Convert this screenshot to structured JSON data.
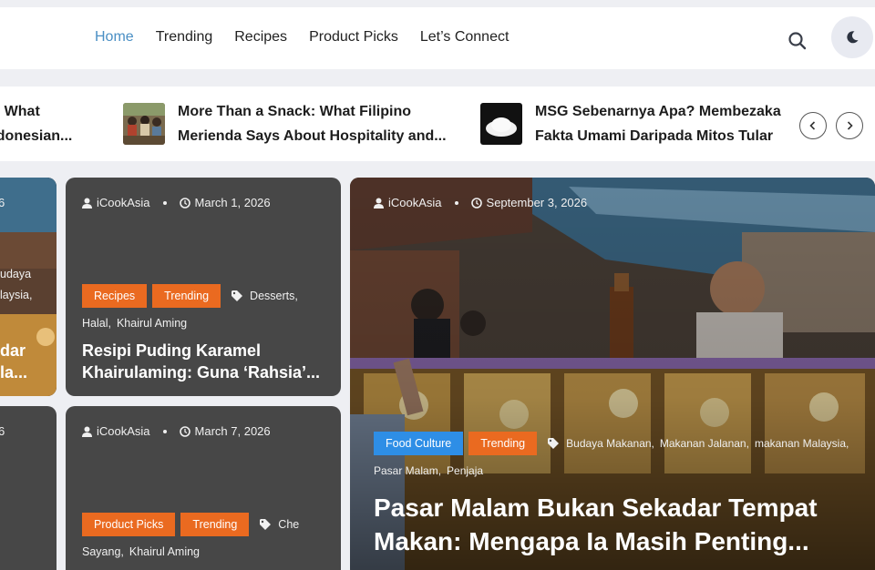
{
  "nav": {
    "items": [
      {
        "label": "Home",
        "active": true
      },
      {
        "label": "Trending"
      },
      {
        "label": "Recipes"
      },
      {
        "label": "Product Picks"
      },
      {
        "label": "Let’s Connect"
      }
    ],
    "search_icon": "search-icon",
    "mode_icon": "moon-icon"
  },
  "ticker": {
    "items": [
      {
        "title": "e: What\nndonesian..."
      },
      {
        "title": "More Than a Snack: What Filipino Merienda Says About Hospitality and..."
      },
      {
        "title": "MSG Sebenarnya Apa? Membezaka Fakta Umami Daripada Mitos Tular"
      }
    ],
    "prev_icon": "chevron-left-icon",
    "next_icon": "chevron-right-icon"
  },
  "cards": {
    "left_top": {
      "partial_tag1": "udaya",
      "partial_tag2": "laysia,",
      "partial_title1": "dar",
      "partial_title2": "la...",
      "partial_meta": "6"
    },
    "left_bottom": {
      "partial_meta": "6"
    },
    "card1": {
      "author": "iCookAsia",
      "date": "March 1, 2026",
      "categories": [
        "Recipes",
        "Trending"
      ],
      "tags_line1": "Desserts,",
      "tags_line2": [
        "Halal,",
        "Khairul Aming"
      ],
      "title": "Resipi Puding Karamel Khairulaming: Guna ‘Rahsia’..."
    },
    "card2": {
      "author": "iCookAsia",
      "date": "March 7, 2026",
      "categories": [
        "Product Picks",
        "Trending"
      ],
      "tags_line1": "Che",
      "tags_line2": [
        "Sayang,",
        "Khairul Aming"
      ]
    },
    "featured": {
      "author": "iCookAsia",
      "date": "September 3, 2026",
      "categories": [
        "Food Culture",
        "Trending"
      ],
      "tags": [
        "Budaya Makanan,",
        "Makanan Jalanan,",
        "makanan Malaysia,",
        "Pasar Malam,",
        "Penjaja"
      ],
      "title": "Pasar Malam Bukan Sekadar Tempat Makan: Mengapa Ia Masih Penting..."
    }
  },
  "colors": {
    "accent": "#4a8fc4",
    "orange": "#ea6a20",
    "blue": "#2e8ee6",
    "card_bg": "#474747"
  }
}
